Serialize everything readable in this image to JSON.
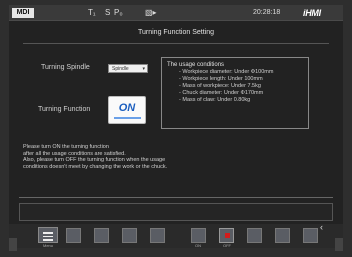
{
  "status": {
    "mode": "MDI",
    "symbols": [
      "T₁",
      "S",
      "P₀",
      "▧▸"
    ],
    "time": "20:28:18",
    "brand": "iHMI"
  },
  "page_title": "Turning Function Setting",
  "spindle": {
    "label": "Turning Spindle",
    "selected": "Spindle"
  },
  "turning_function": {
    "label": "Turning Function",
    "button_label": "ON"
  },
  "conditions": {
    "heading": "The usage conditions",
    "items": [
      "- Workpiece diameter: Under Φ100mm",
      "- Workpiece length: Under 100mm",
      "- Mass of workpiece: Under 7.5kg",
      "- Chuck diameter: Under Φ170mm",
      "- Mass of claw: Under 0.80kg"
    ]
  },
  "message_lines": [
    "Please turn ON the turning function",
    "after all the usage conditions are satisfied.",
    "Also, please turn OFF the turning function when the usage",
    "conditions doesn't meet by changing the work or the chuck."
  ],
  "softkeys": {
    "menu_label": "Menu",
    "on_label": "ON",
    "off_label": "OFF",
    "accent": "#d21b1b"
  }
}
